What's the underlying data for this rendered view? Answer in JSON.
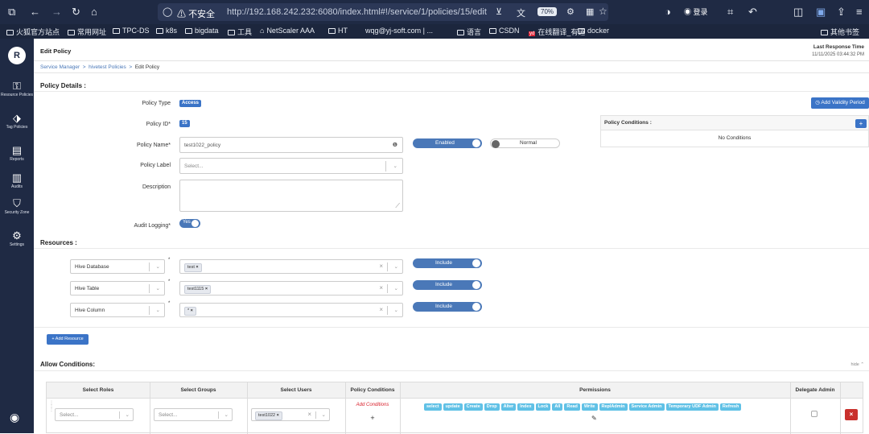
{
  "browser": {
    "security_label": "不安全",
    "url": "http://192.168.242.232:6080/index.html#!/service/1/policies/15/edit",
    "zoom": "70%",
    "login_label": "登录",
    "bookmarks": [
      "火狐官方站点",
      "常用网址",
      "TPC-DS",
      "k8s",
      "bigdata",
      "工具",
      "NetScaler AAA",
      "HT",
      "wqg@yj-soft.com | ...",
      "语言",
      "CSDN",
      "在线翻译_有道",
      "docker"
    ],
    "other_bookmarks": "其他书签"
  },
  "sidebar": {
    "items": [
      {
        "label": "Resource Policies",
        "icon": "key-icon"
      },
      {
        "label": "Tag Policies",
        "icon": "tag-icon"
      },
      {
        "label": "Reports",
        "icon": "report-icon"
      },
      {
        "label": "Audits",
        "icon": "clipboard-icon"
      },
      {
        "label": "Security Zone",
        "icon": "shield-icon"
      },
      {
        "label": "Settings",
        "icon": "gear-icon"
      }
    ]
  },
  "header": {
    "title": "Edit Policy",
    "breadcrumb": [
      "Service Manager",
      "hivetest Policies",
      "Edit Policy"
    ],
    "last_response_label": "Last Response Time",
    "last_response_value": "11/11/2025 03:44:32 PM"
  },
  "policy_details": {
    "section_title": "Policy Details :",
    "policy_type_label": "Policy Type",
    "policy_type_value": "Access",
    "policy_id_label": "Policy ID*",
    "policy_id_value": "15",
    "policy_name_label": "Policy Name*",
    "policy_name_value": "test1022_policy",
    "enabled_label": "Enabled",
    "normal_label": "Normal",
    "policy_label_label": "Policy Label",
    "policy_label_placeholder": "Select...",
    "description_label": "Description",
    "audit_logging_label": "Audit Logging*",
    "audit_logging_value": "Yes"
  },
  "validity": {
    "add_button": "Add Validity Period",
    "conditions_title": "Policy Conditions :",
    "no_conditions": "No Conditions"
  },
  "resources": {
    "section_title": "Resources :",
    "rows": [
      {
        "type": "Hive Database",
        "value": "test",
        "toggle": "Include"
      },
      {
        "type": "Hive Table",
        "value": "test1115",
        "toggle": "Include"
      },
      {
        "type": "Hive Column",
        "value": "*",
        "toggle": "Include"
      }
    ],
    "add_resource": "Add Resource"
  },
  "allow_conditions": {
    "section_title": "Allow Conditions:",
    "hide_label": "hide",
    "columns": [
      "Select Roles",
      "Select Groups",
      "Select Users",
      "Policy Conditions",
      "Permissions",
      "Delegate Admin"
    ],
    "row": {
      "roles_placeholder": "Select...",
      "groups_placeholder": "Select...",
      "user": "test1022",
      "add_conditions": "Add Conditions",
      "permissions": [
        "select",
        "update",
        "Create",
        "Drop",
        "Alter",
        "Index",
        "Lock",
        "All",
        "Read",
        "Write",
        "ReplAdmin",
        "Service Admin",
        "Temporary UDF Admin",
        "Refresh"
      ]
    }
  }
}
